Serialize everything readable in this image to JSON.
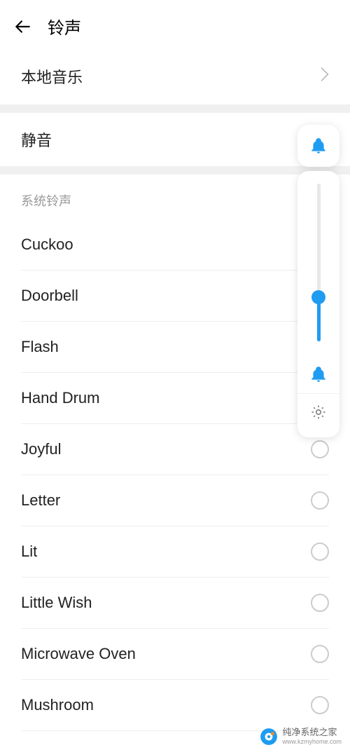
{
  "header": {
    "title": "铃声"
  },
  "nav": {
    "local_music": "本地音乐"
  },
  "mute": {
    "label": "静音"
  },
  "section": {
    "system_ringtones": "系统铃声"
  },
  "ringtones": [
    {
      "label": "Cuckoo"
    },
    {
      "label": "Doorbell"
    },
    {
      "label": "Flash"
    },
    {
      "label": "Hand Drum"
    },
    {
      "label": "Joyful"
    },
    {
      "label": "Letter"
    },
    {
      "label": "Lit"
    },
    {
      "label": "Little Wish"
    },
    {
      "label": "Microwave Oven"
    },
    {
      "label": "Mushroom"
    }
  ],
  "volume": {
    "level_percent": 30
  },
  "watermark": {
    "title": "纯净系统之家",
    "url": "www.kzmyhome.com"
  },
  "colors": {
    "accent": "#1e9cf1"
  }
}
